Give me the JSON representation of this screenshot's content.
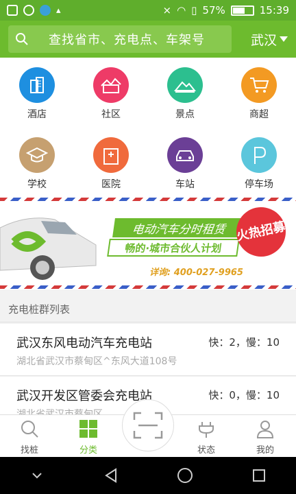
{
  "status_bar": {
    "battery": "57%",
    "time": "15:39",
    "battery_level": 0.57
  },
  "header": {
    "search_placeholder": "查找省市、充电点、车架号",
    "city": "武汉"
  },
  "categories": [
    {
      "label": "酒店",
      "color": "#1e8fe0",
      "icon": "hotel-icon"
    },
    {
      "label": "社区",
      "color": "#ee3b67",
      "icon": "community-icon"
    },
    {
      "label": "景点",
      "color": "#2cbf8f",
      "icon": "scenic-icon"
    },
    {
      "label": "商超",
      "color": "#f39a23",
      "icon": "shopping-cart-icon"
    },
    {
      "label": "学校",
      "color": "#c6a070",
      "icon": "school-icon"
    },
    {
      "label": "医院",
      "color": "#f06a3c",
      "icon": "hospital-icon"
    },
    {
      "label": "车站",
      "color": "#6b3f96",
      "icon": "car-icon"
    },
    {
      "label": "停车场",
      "color": "#5bc6dc",
      "icon": "parking-icon"
    }
  ],
  "banner": {
    "title": "电动汽车分时租赁",
    "subtitle": "畅的·城市合伙人计划",
    "badge": "火热招募",
    "phone": "详询: 400-027-9965"
  },
  "list": {
    "header": "充电桩群列表",
    "items": [
      {
        "name": "武汉东风电动汽车充电站",
        "count": "快：2，慢：10",
        "address": "湖北省武汉市蔡甸区^东风大道108号"
      },
      {
        "name": "武汉开发区管委会充电站",
        "count": "快：0，慢：10",
        "address": "湖北省武汉市蔡甸区"
      }
    ]
  },
  "tabs": [
    {
      "label": "找桩",
      "icon": "search-icon"
    },
    {
      "label": "分类",
      "icon": "grid-icon",
      "active": true
    },
    {
      "label": "状态",
      "icon": "plug-icon"
    },
    {
      "label": "我的",
      "icon": "user-icon"
    }
  ],
  "colors": {
    "brand": "#6dbb2e"
  }
}
